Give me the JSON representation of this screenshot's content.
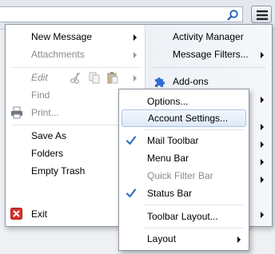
{
  "toolbar": {
    "search_placeholder": "",
    "search_icon": "magnifier-icon",
    "menu_button_icon": "hamburger-icon"
  },
  "app_menu": {
    "left": {
      "new_message": "New Message",
      "attachments": "Attachments",
      "edit": "Edit",
      "find": "Find",
      "print": "Print...",
      "save_as": "Save As",
      "folders": "Folders",
      "empty_trash": "Empty Trash",
      "exit": "Exit"
    },
    "right": {
      "activity_manager": "Activity Manager",
      "message_filters": "Message Filters...",
      "add_ons": "Add-ons"
    }
  },
  "options_submenu": {
    "options": "Options...",
    "account_settings": "Account Settings...",
    "mail_toolbar": {
      "label": "Mail Toolbar",
      "checked": true
    },
    "menu_bar": {
      "label": "Menu Bar",
      "checked": false
    },
    "quick_filter_bar": {
      "label": "Quick Filter Bar",
      "checked": false,
      "disabled": true
    },
    "status_bar": {
      "label": "Status Bar",
      "checked": true
    },
    "toolbar_layout": "Toolbar Layout...",
    "layout": "Layout"
  },
  "colors": {
    "accent": "#2f6fc4",
    "exit_icon": "#d8322c",
    "addons_icon": "#2d6ed6"
  }
}
